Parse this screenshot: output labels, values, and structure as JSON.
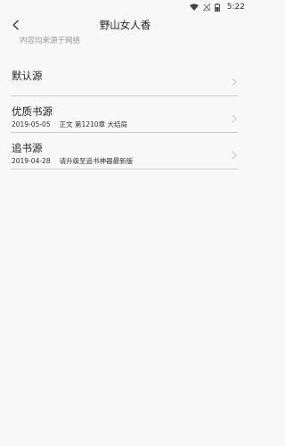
{
  "status_bar": {
    "time": "5:22",
    "icons": [
      "wifi-icon",
      "no-signal-icon",
      "battery-icon"
    ]
  },
  "header": {
    "title": "野山女人香",
    "subtitle": "内容均来源于网络",
    "back_icon": "chevron-left-icon"
  },
  "sources": [
    {
      "name": "默认源",
      "date": "",
      "chapter": ""
    },
    {
      "name": "优质书源",
      "date": "2019-05-05",
      "chapter": "正文 第1210章 大结局"
    },
    {
      "name": "追书源",
      "date": "2019-04-28",
      "chapter": "请升级至追书神器最新版"
    }
  ],
  "colors": {
    "background": "#f8f8f8",
    "divider": "#cfcfcf",
    "subtitle": "#9a9a9a",
    "chevron": "#c8c8c8"
  }
}
